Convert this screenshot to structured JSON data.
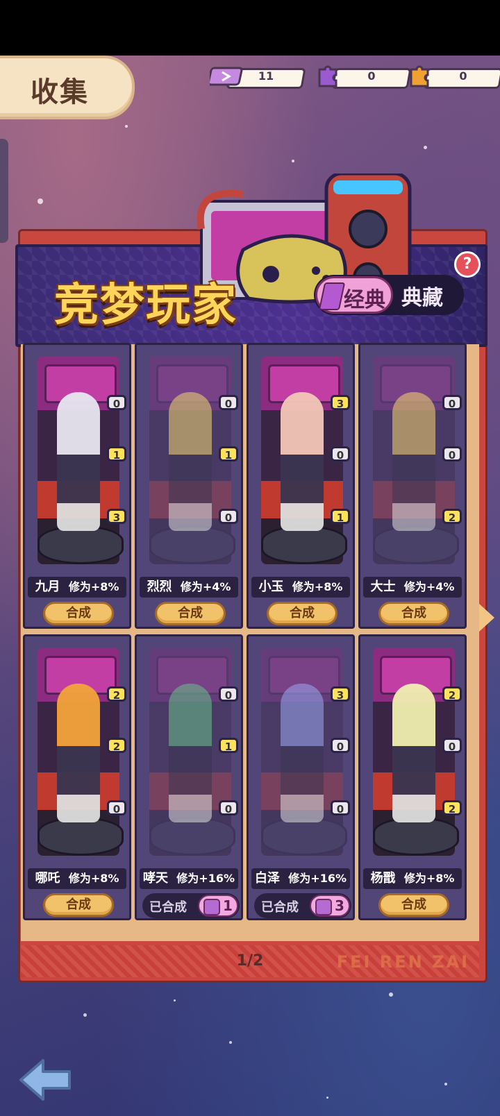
{
  "header": {
    "tab_title": "收集",
    "resources": [
      {
        "icon": "ticket-icon",
        "value": "11"
      },
      {
        "icon": "purple-puzzle-icon",
        "value": "0"
      },
      {
        "icon": "orange-puzzle-icon",
        "value": "0"
      }
    ]
  },
  "banner": {
    "title": "竞梦玩家",
    "toggle": {
      "active": "经典",
      "inactive": "典藏"
    },
    "help": "?"
  },
  "bonus_prefix": "修为",
  "cards": [
    {
      "name": "九月",
      "bonus": "+8%",
      "pieces": [
        "0",
        "1",
        "3"
      ],
      "action": "合成",
      "combined": false
    },
    {
      "name": "烈烈",
      "bonus": "+4%",
      "pieces": [
        "0",
        "1",
        "0"
      ],
      "action": "合成",
      "combined": false
    },
    {
      "name": "小玉",
      "bonus": "+8%",
      "pieces": [
        "3",
        "0",
        "1"
      ],
      "action": "合成",
      "combined": false
    },
    {
      "name": "大士",
      "bonus": "+4%",
      "pieces": [
        "0",
        "0",
        "2"
      ],
      "action": "合成",
      "combined": false
    },
    {
      "name": "哪吒",
      "bonus": "+8%",
      "pieces": [
        "2",
        "2",
        "0"
      ],
      "action": "合成",
      "combined": false
    },
    {
      "name": "哮天",
      "bonus": "+16%",
      "pieces": [
        "0",
        "1",
        "0"
      ],
      "action": "已合成",
      "combined": true,
      "count": "1"
    },
    {
      "name": "白泽",
      "bonus": "+16%",
      "pieces": [
        "3",
        "0",
        "0"
      ],
      "action": "已合成",
      "combined": true,
      "count": "3"
    },
    {
      "name": "杨戬",
      "bonus": "+8%",
      "pieces": [
        "2",
        "0",
        "2"
      ],
      "action": "合成",
      "combined": false
    }
  ],
  "footer": {
    "page": "1/2",
    "brand": "FEI REN ZAI"
  },
  "colors": {
    "accent": "#f1c26a",
    "panel": "#524577",
    "badge_positive": "#ffe25b",
    "title": "#ffd65a"
  }
}
